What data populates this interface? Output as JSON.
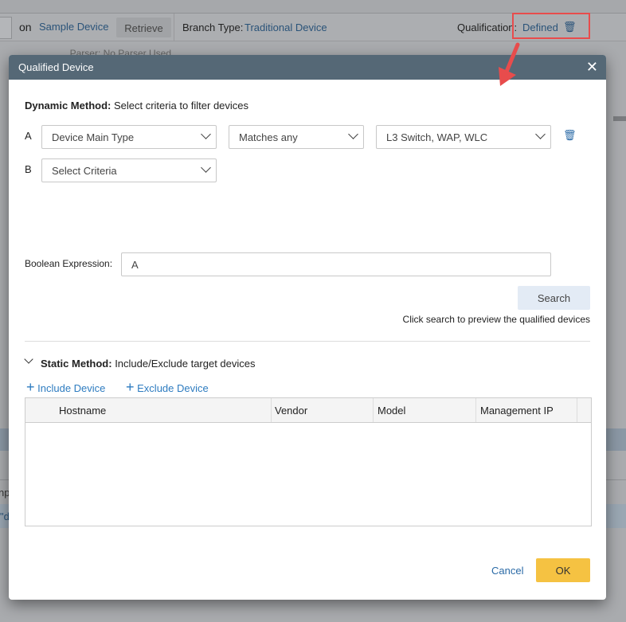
{
  "background": {
    "on_label": "on",
    "sample_device": "Sample Device",
    "retrieve": "Retrieve",
    "branch_type_label": "Branch Type:",
    "branch_type_value": "Traditional Device",
    "qualification_label": "Qualification:",
    "qualification_value": "Defined",
    "parser": "Parser: No Parser Used",
    "fragment_1": "np",
    "fragment_2": "\"d"
  },
  "dialog": {
    "title": "Qualified Device",
    "dynamic_label": "Dynamic Method:",
    "dynamic_desc": "Select criteria to filter devices",
    "rows": [
      {
        "letter": "A",
        "field": "Device Main Type",
        "operator": "Matches any",
        "value": "L3 Switch, WAP, WLC"
      },
      {
        "letter": "B",
        "field": "Select Criteria"
      }
    ],
    "boolean_label": "Boolean Expression:",
    "boolean_value": "A",
    "search": "Search",
    "search_hint": "Click search to preview the qualified devices",
    "static_label": "Static Method:",
    "static_desc": "Include/Exclude target devices",
    "include": "Include Device",
    "exclude": "Exclude Device",
    "columns": [
      "Hostname",
      "Vendor",
      "Model",
      "Management IP"
    ],
    "cancel": "Cancel",
    "ok": "OK"
  },
  "colors": {
    "accent": "#2e7cc0",
    "ok": "#f5c242",
    "header": "#556876",
    "highlight": "#e84c4c"
  }
}
